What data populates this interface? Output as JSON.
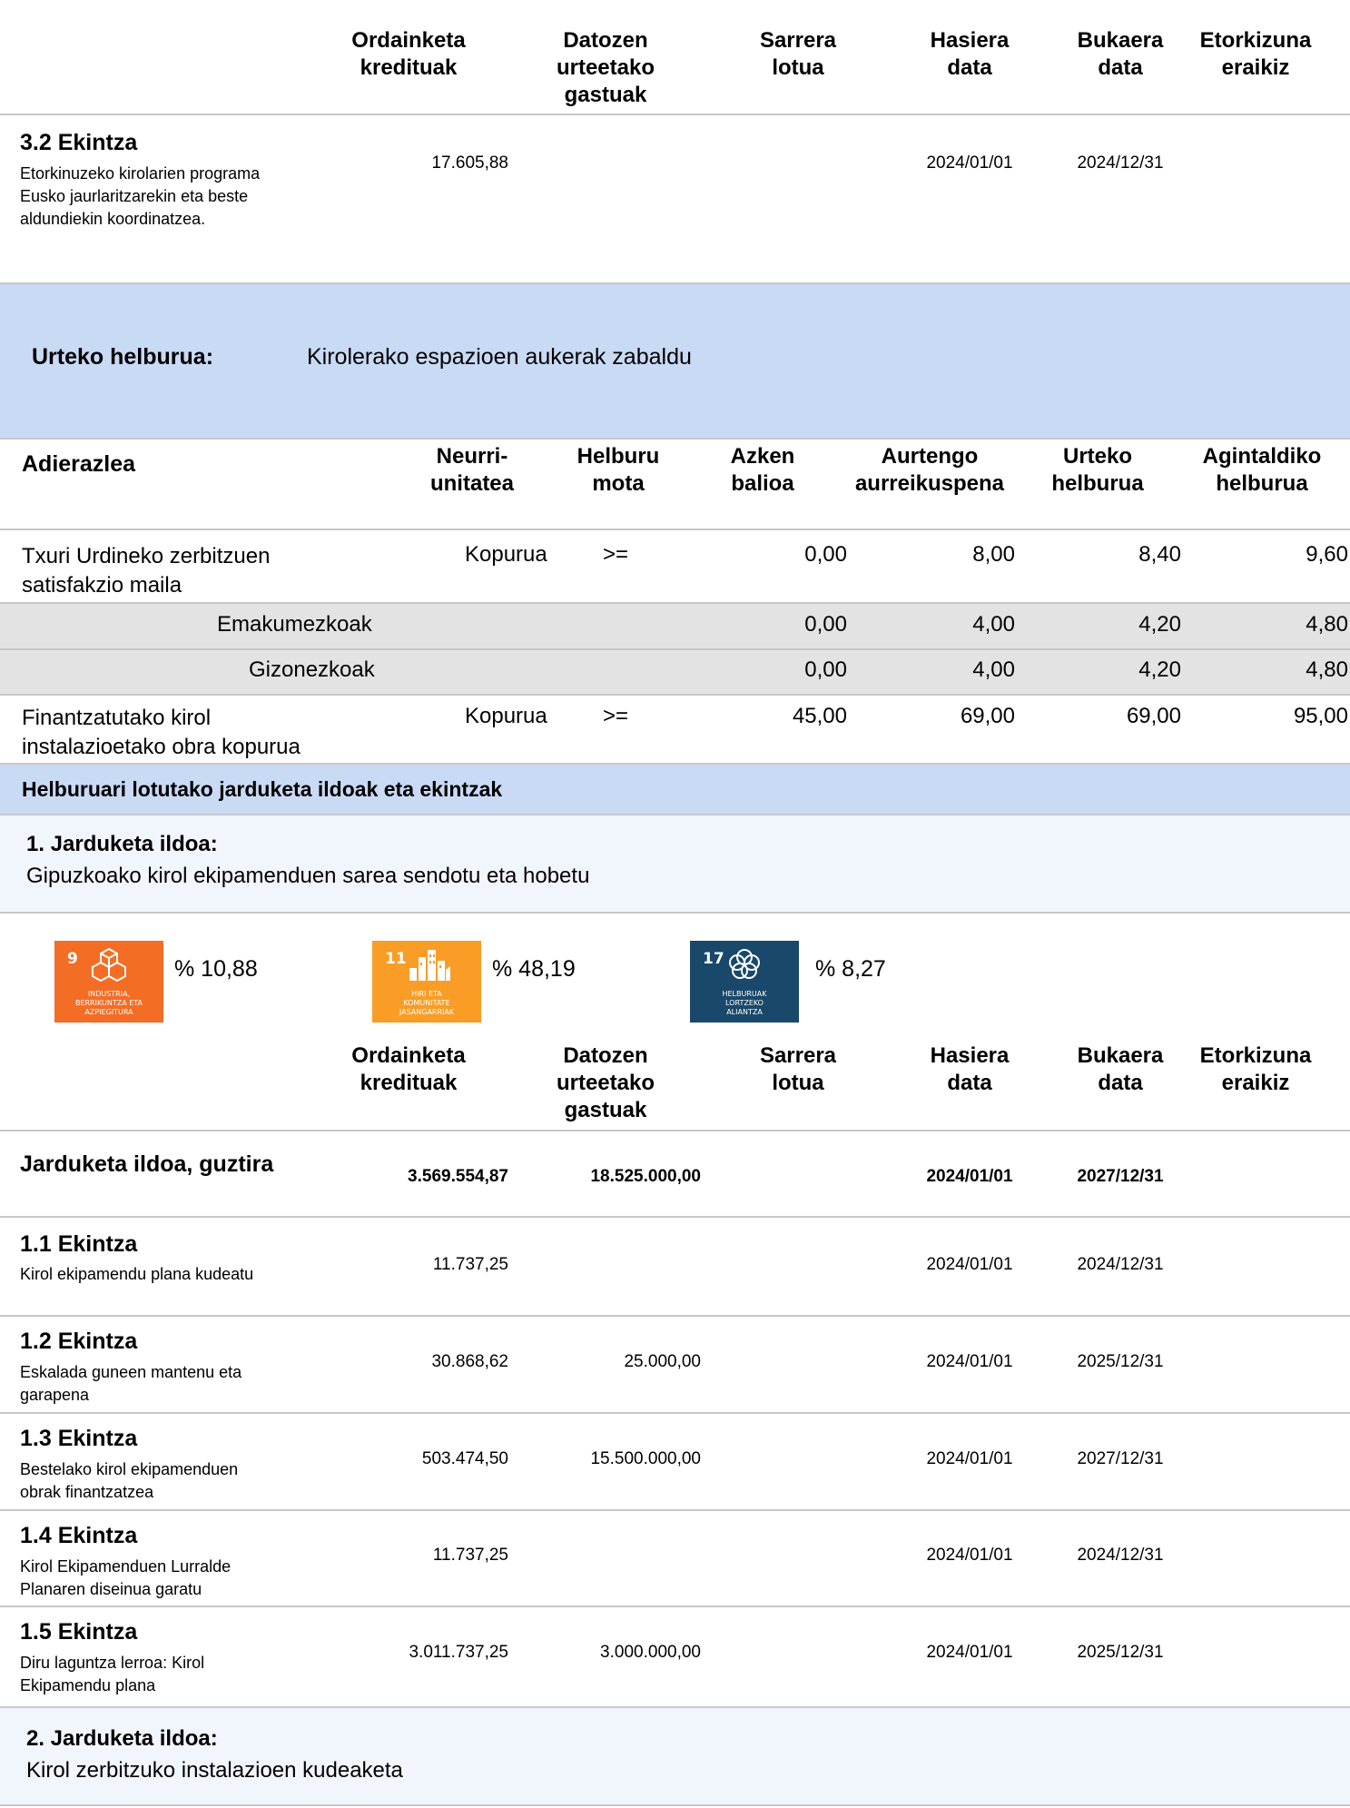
{
  "cols": {
    "ordainketa": "Ordainketa\nkredituak",
    "datozen": "Datozen\nurteetako\ngastuak",
    "sarrera": "Sarrera\nlotua",
    "hasiera": "Hasiera\ndata",
    "bukaera": "Bukaera\ndata",
    "etorkizuna": "Etorkizuna\neraikiz"
  },
  "ekintza32": {
    "title": "3.2 Ekintza",
    "desc": "Etorkinuzeko kirolarien programa\nEusko jaurlaritzarekin eta beste\naldundiekin koordinatzea.",
    "ordainketa": "17.605,88",
    "hasiera": "2024/01/01",
    "bukaera": "2024/12/31"
  },
  "urteko": {
    "label": "Urteko helburua:",
    "text": "Kirolerako espazioen aukerak zabaldu"
  },
  "ind_header": {
    "adierazlea": "Adierazlea",
    "neurri": "Neurri-\nunitatea",
    "mota": "Helburu\nmota",
    "azken": "Azken\nbalioa",
    "aurtengo": "Aurtengo\naurreikuspena",
    "urteko": "Urteko\nhelburua",
    "agintaldi": "Agintaldiko\nhelburua"
  },
  "indicators": [
    {
      "name": "Txuri Urdineko zerbitzuen\nsatisfakzio maila",
      "unit": "Kopurua",
      "type": ">=",
      "azken": "0,00",
      "aurtengo": "8,00",
      "urteko": "8,40",
      "agintaldi": "9,60"
    },
    {
      "name": "Emakumezkoak",
      "azken": "0,00",
      "aurtengo": "4,00",
      "urteko": "4,20",
      "agintaldi": "4,80"
    },
    {
      "name": "Gizonezkoak",
      "azken": "0,00",
      "aurtengo": "4,00",
      "urteko": "4,20",
      "agintaldi": "4,80"
    },
    {
      "name": "Finantzatutako kirol\ninstalazioetako obra kopurua",
      "unit": "Kopurua",
      "type": ">=",
      "azken": "45,00",
      "aurtengo": "69,00",
      "urteko": "69,00",
      "agintaldi": "95,00"
    }
  ],
  "lotutako": "Helburuari lotutako jarduketa ildoak eta ekintzak",
  "ildoa1": {
    "title": "1. Jarduketa ildoa:",
    "text": "Gipuzkoako kirol ekipamenduen sarea sendotu eta hobetu"
  },
  "sdgs": [
    {
      "num": "9",
      "caption": "INDUSTRIA,\nBERRIKUNTZA ETA\nAZPIEGITURA",
      "pct": "% 10,88",
      "color": "#f36d25",
      "icon": "industry-cubes-icon"
    },
    {
      "num": "11",
      "caption": "HIRI ETA\nKOMUNITATE\nJASANGARRIAK",
      "pct": "% 48,19",
      "color": "#f99d26",
      "icon": "city-buildings-icon"
    },
    {
      "num": "17",
      "caption": "HELBURUAK\nLORTZEKO\nALIANTZA",
      "pct": "% 8,27",
      "color": "#19486a",
      "icon": "partnership-rings-icon"
    }
  ],
  "guztira": {
    "label": "Jarduketa ildoa, guztira",
    "ordainketa": "3.569.554,87",
    "datozen": "18.525.000,00",
    "hasiera": "2024/01/01",
    "bukaera": "2027/12/31"
  },
  "ekintzak": [
    {
      "title": "1.1 Ekintza",
      "desc": "Kirol ekipamendu plana kudeatu",
      "ordainketa": "11.737,25",
      "datozen": "",
      "hasiera": "2024/01/01",
      "bukaera": "2024/12/31"
    },
    {
      "title": "1.2 Ekintza",
      "desc": "Eskalada guneen mantenu eta\ngarapena",
      "ordainketa": "30.868,62",
      "datozen": "25.000,00",
      "hasiera": "2024/01/01",
      "bukaera": "2025/12/31"
    },
    {
      "title": "1.3 Ekintza",
      "desc": "Bestelako kirol ekipamenduen\nobrak finantzatzea",
      "ordainketa": "503.474,50",
      "datozen": "15.500.000,00",
      "hasiera": "2024/01/01",
      "bukaera": "2027/12/31"
    },
    {
      "title": "1.4 Ekintza",
      "desc": "Kirol Ekipamenduen Lurralde\nPlanaren diseinua garatu",
      "ordainketa": "11.737,25",
      "datozen": "",
      "hasiera": "2024/01/01",
      "bukaera": "2024/12/31"
    },
    {
      "title": "1.5 Ekintza",
      "desc": "Diru laguntza lerroa: Kirol\nEkipamendu plana",
      "ordainketa": "3.011.737,25",
      "datozen": "3.000.000,00",
      "hasiera": "2024/01/01",
      "bukaera": "2025/12/31"
    }
  ],
  "ildoa2": {
    "title": "2. Jarduketa ildoa:",
    "text": "Kirol zerbitzuko instalazioen kudeaketa"
  },
  "colors": {
    "band_blue": "#c9daf5",
    "band_light": "#f1f5fc",
    "row_grey": "#e3e3e3"
  }
}
